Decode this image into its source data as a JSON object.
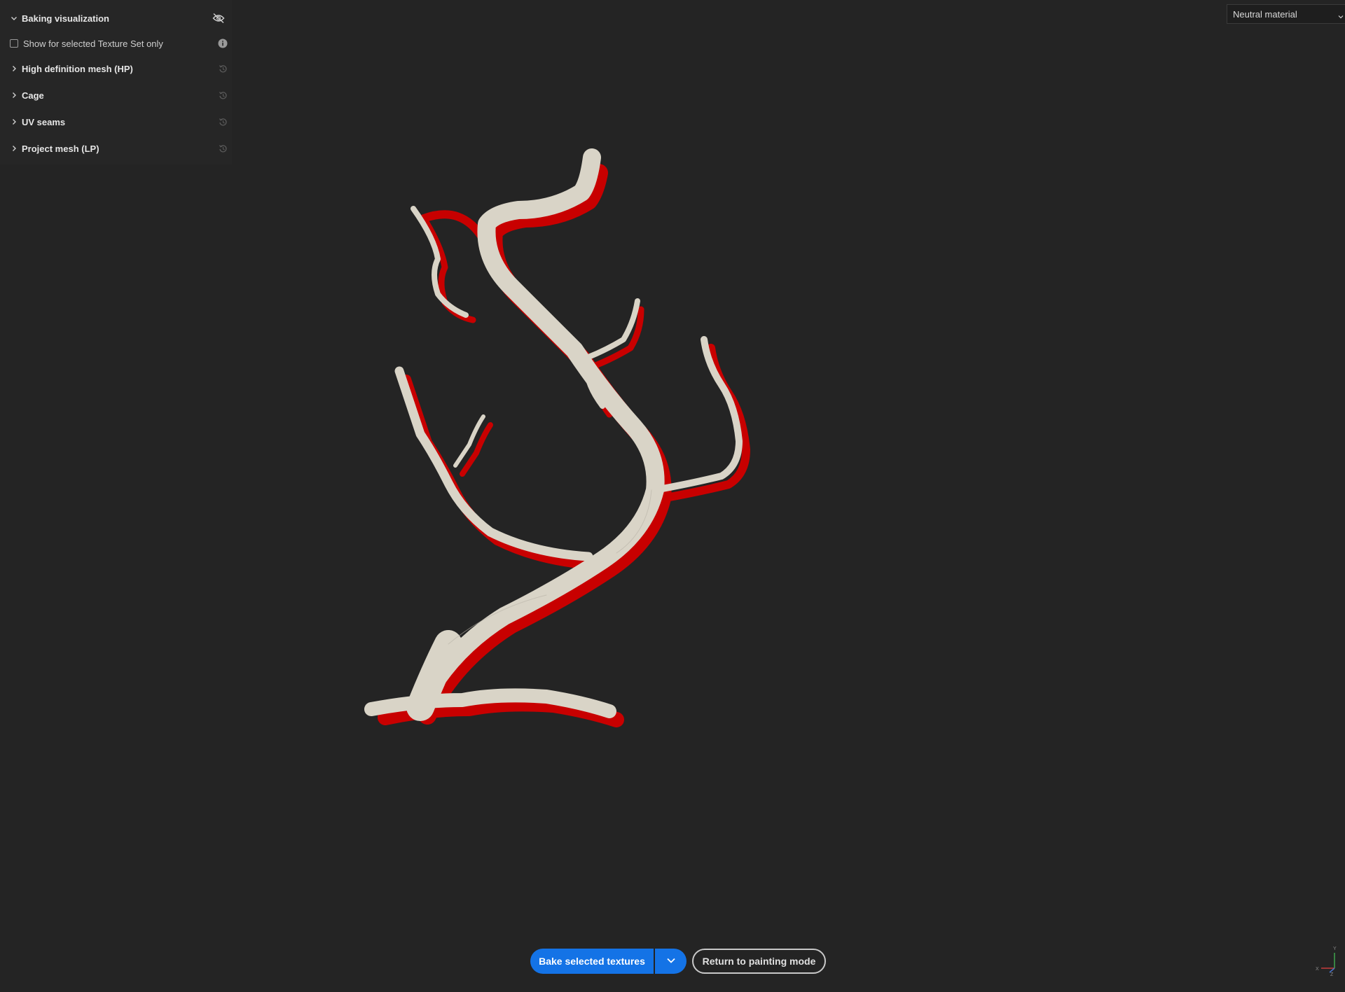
{
  "panel": {
    "baking_visualization": "Baking visualization",
    "show_selected_only": "Show for selected Texture Set only",
    "show_selected_checked": false,
    "sections": [
      {
        "label": "High definition mesh (HP)"
      },
      {
        "label": "Cage"
      },
      {
        "label": "UV seams"
      },
      {
        "label": "Project mesh (LP)"
      }
    ]
  },
  "viewport": {
    "material": "Neutral material",
    "axis": {
      "x": "X",
      "y": "Y",
      "z": "Z"
    }
  },
  "actions": {
    "bake": "Bake selected textures",
    "return": "Return to painting mode"
  },
  "colors": {
    "accent": "#1473e6",
    "background": "#242424",
    "mesh": "#d9d4c7",
    "cage": "#d00000"
  },
  "icons": {
    "visibility_toggle": "eye-off-icon",
    "info": "info-icon",
    "reset": "reset-icon",
    "expand": "chevron-right-icon",
    "collapse": "chevron-down-icon",
    "dropdown": "chevron-down-icon"
  }
}
